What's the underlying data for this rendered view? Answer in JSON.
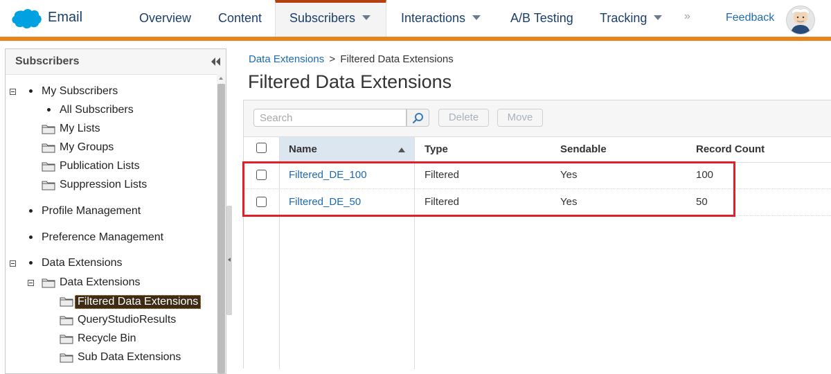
{
  "header": {
    "app_name": "Email",
    "nav": [
      {
        "label": "Overview"
      },
      {
        "label": "Content"
      },
      {
        "label": "Subscribers"
      },
      {
        "label": "Interactions"
      },
      {
        "label": "A/B Testing"
      },
      {
        "label": "Tracking"
      }
    ],
    "more": "»",
    "feedback": "Feedback",
    "colors": {
      "accent_bar": "#e8831c",
      "active_tab_top": "#b3420f",
      "link": "#1d6ab2"
    }
  },
  "sidebar": {
    "title": "Subscribers",
    "tree": [
      {
        "label": "My Subscribers"
      },
      {
        "label": "All Subscribers"
      },
      {
        "label": "My Lists"
      },
      {
        "label": "My Groups"
      },
      {
        "label": "Publication Lists"
      },
      {
        "label": "Suppression Lists"
      },
      {
        "label": "Profile Management"
      },
      {
        "label": "Preference Management"
      },
      {
        "label": "Data Extensions"
      },
      {
        "label": "Data Extensions"
      },
      {
        "label": "Filtered Data Extensions"
      },
      {
        "label": "QueryStudioResults"
      },
      {
        "label": "Recycle Bin"
      },
      {
        "label": "Sub Data Extensions"
      }
    ],
    "selected": "Filtered Data Extensions"
  },
  "main": {
    "breadcrumb": {
      "parent": "Data Extensions",
      "separator": ">",
      "current": "Filtered Data Extensions"
    },
    "title": "Filtered Data Extensions",
    "toolbar": {
      "search_placeholder": "Search",
      "delete_label": "Delete",
      "move_label": "Move"
    },
    "columns": [
      "Name",
      "Type",
      "Sendable",
      "Record Count"
    ],
    "sort": {
      "column": "Name",
      "direction": "ascending"
    },
    "rows": [
      {
        "name": "Filtered_DE_100",
        "type": "Filtered",
        "sendable": "Yes",
        "record_count": "100"
      },
      {
        "name": "Filtered_DE_50",
        "type": "Filtered",
        "sendable": "Yes",
        "record_count": "50"
      }
    ],
    "highlight_color": "#e21f26"
  }
}
